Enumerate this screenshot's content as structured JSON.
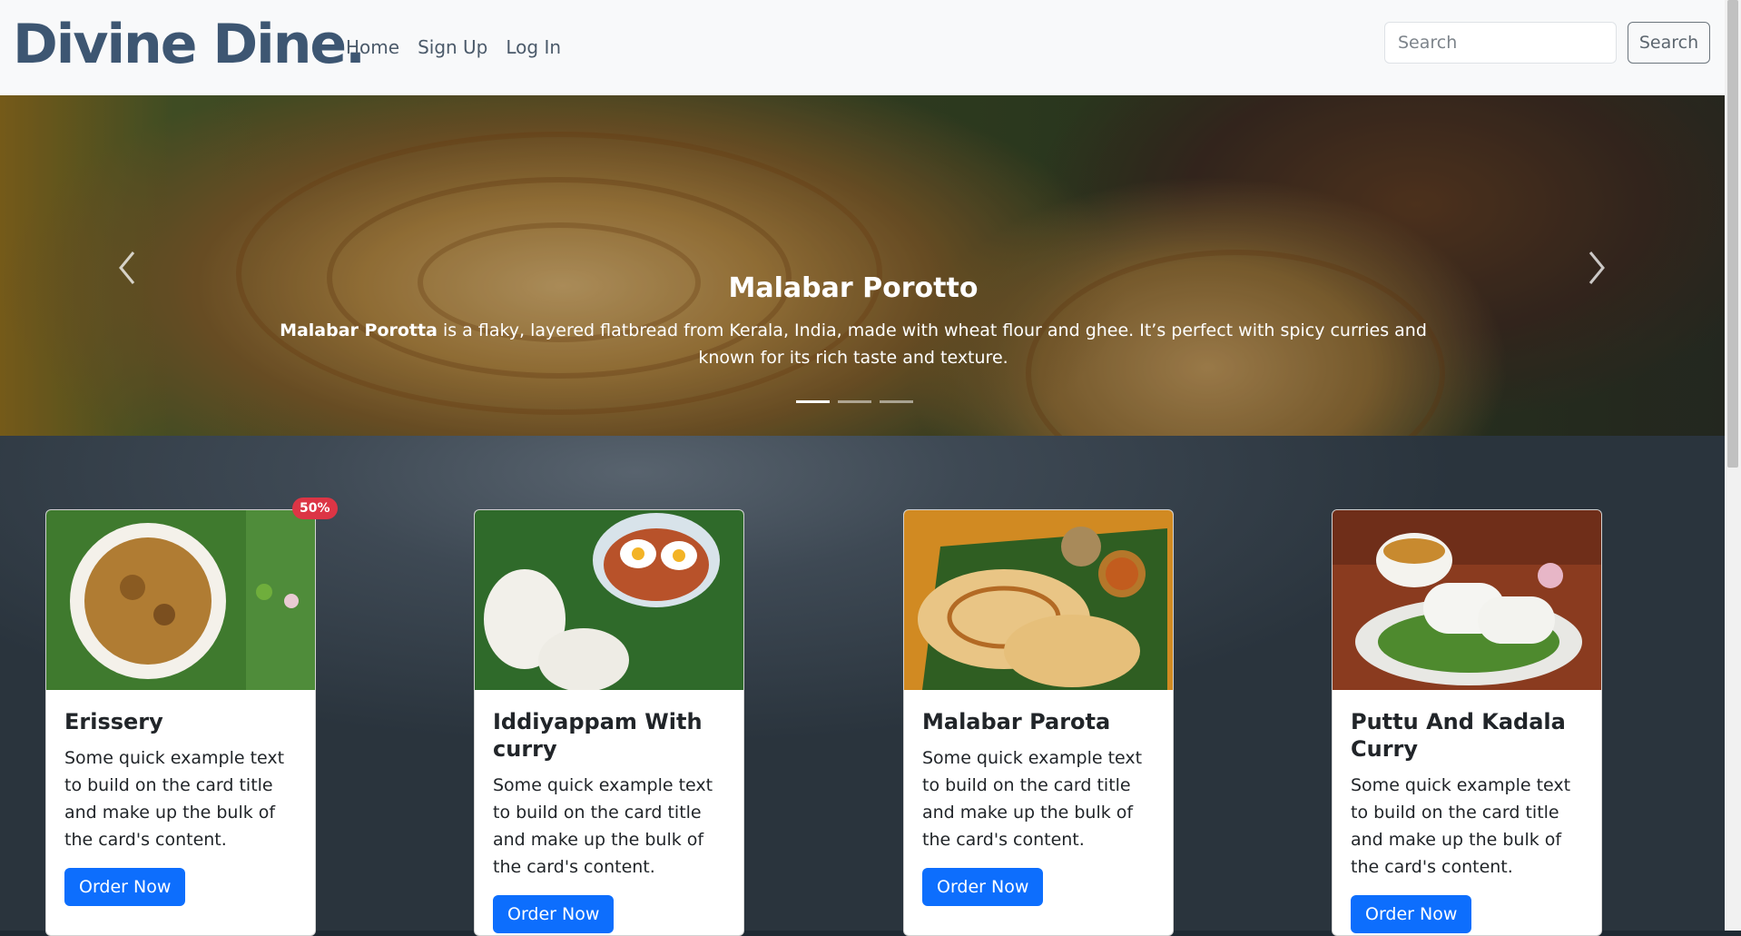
{
  "navbar": {
    "brand": "Divine Dine.",
    "links": [
      "Home",
      "Sign Up",
      "Log In"
    ],
    "search_placeholder": "Search",
    "search_button": "Search"
  },
  "hero": {
    "title": "Malabar Porotto",
    "text_bold": "Malabar Porotta",
    "text_rest": " is a flaky, layered flatbread from Kerala, India, made with wheat flour and ghee. It’s perfect with spicy curries and known for its rich taste and texture.",
    "slide_count": 3,
    "active_slide": 1
  },
  "cards": [
    {
      "title": "Erissery",
      "text": "Some quick example text to build on the card title and make up the bulk of the card's content.",
      "button": "Order Now",
      "badge": "50%"
    },
    {
      "title": "Iddiyappam With curry",
      "text": "Some quick example text to build on the card title and make up the bulk of the card's content.",
      "button": "Order Now"
    },
    {
      "title": "Malabar Parota",
      "text": "Some quick example text to build on the card title and make up the bulk of the card's content.",
      "button": "Order Now"
    },
    {
      "title": "Puttu And Kadala Curry",
      "text": "Some quick example text to build on the card title and make up the bulk of the card's content.",
      "button": "Order Now"
    }
  ],
  "colors": {
    "brand": "#3d5672",
    "primary_button": "#0d6efd",
    "badge": "#dc3545",
    "navbar_bg": "#f8f9fa"
  }
}
